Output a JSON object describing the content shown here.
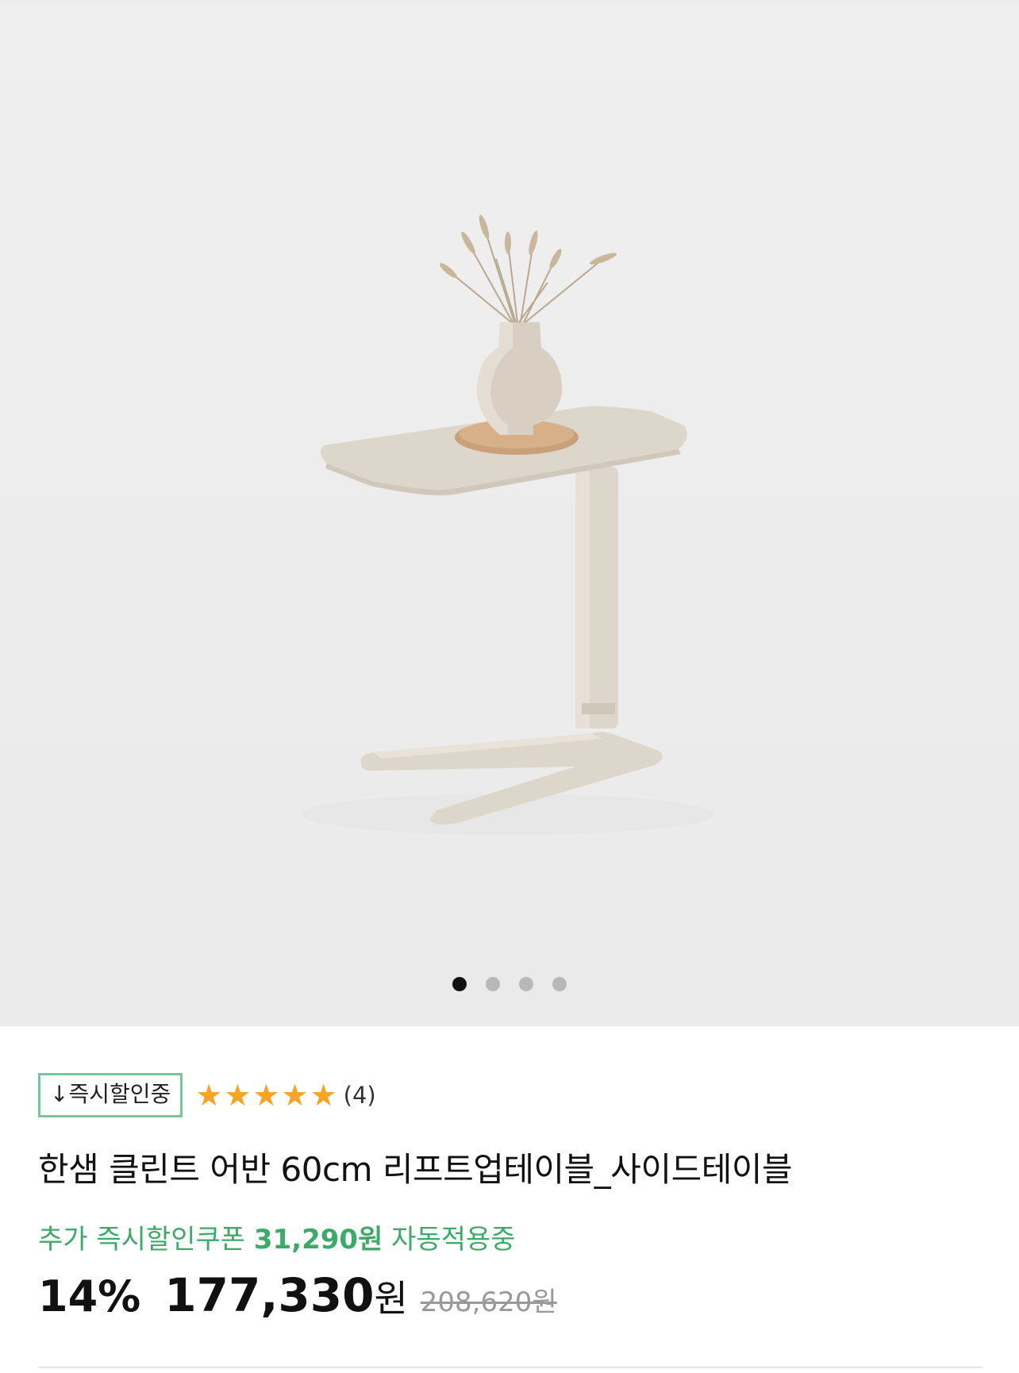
{
  "gallery": {
    "image_alt": "한샘 클린트 어반 60cm 리프트업테이블 사이드테이블 제품 이미지",
    "page_count": 4,
    "active_index": 0
  },
  "badge": "↓즉시할인중",
  "rating": {
    "stars": 5,
    "count_label": "(4)"
  },
  "product": {
    "title": "한샘 클린트 어반 60cm 리프트업테이블_사이드테이블"
  },
  "coupon": {
    "prefix": "추가 즉시할인쿠폰",
    "amount": "31,290원",
    "suffix": "자동적용중"
  },
  "price": {
    "discount": "14%",
    "sale": "177,330",
    "currency": "원",
    "original": "208,620원"
  },
  "colors": {
    "accent_green": "#3daa6a",
    "badge_border": "#72c89a",
    "star": "#f5a425"
  }
}
